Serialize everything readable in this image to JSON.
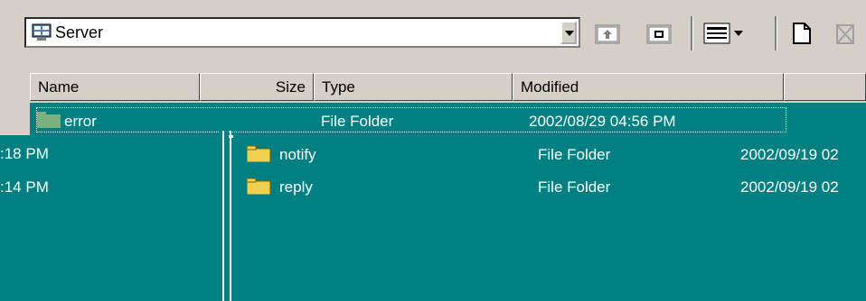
{
  "address": {
    "value": "Server"
  },
  "toolbar": {
    "up_icon": "up-folder-icon",
    "new_folder_icon": "new-folder-icon",
    "views_icon": "details-view-icon",
    "new_file_icon": "new-file-icon",
    "delete_icon": "delete-icon"
  },
  "columns": [
    "Name",
    "Size",
    "Type",
    "Modified"
  ],
  "rows": [
    {
      "name": "error",
      "type": "File Folder",
      "modified": "2002/08/29 04:56 PM",
      "selected": true
    },
    {
      "name": "notify",
      "type": "File Folder",
      "modified": "2002/09/19 02"
    },
    {
      "name": "reply",
      "type": "File Folder",
      "modified": "2002/09/19 02"
    }
  ],
  "left_pane": {
    "times": [
      ":18 PM",
      ":14 PM"
    ]
  },
  "colors": {
    "teal": "#008080",
    "face": "#d4d0c8"
  }
}
